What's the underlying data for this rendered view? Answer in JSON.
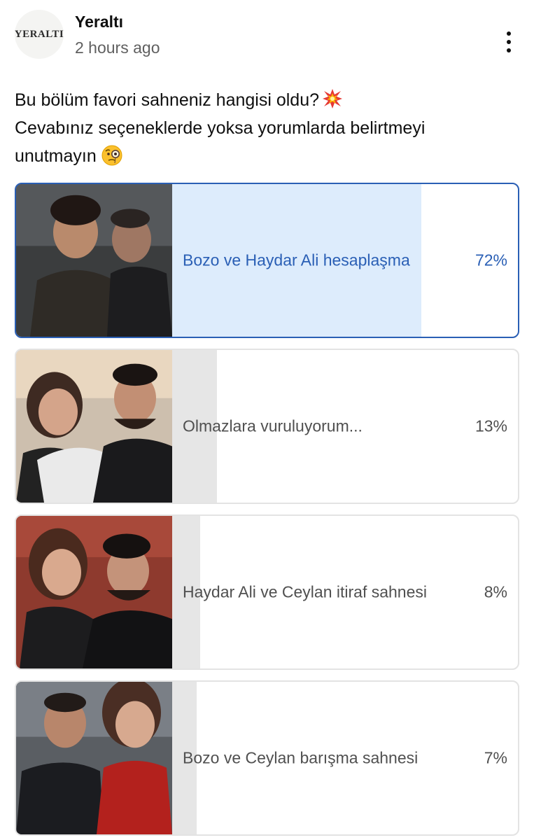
{
  "post": {
    "channel_name": "Yeraltı",
    "avatar_text": "YERALTI",
    "time": "2 hours ago",
    "menu_icon": "more-vertical-icon",
    "text_lines": [
      "Bu bölüm favori sahneniz hangisi oldu?",
      "Cevabınız seçeneklerde yoksa yorumlarda belirtmeyi",
      "unutmayın"
    ],
    "emojis": [
      "collision-emoji",
      "face-with-monocle-emoji"
    ]
  },
  "poll": {
    "accent_color": "#2a5fb5",
    "selected_fill_color": "#ddecfc",
    "fill_color": "#e6e6e6",
    "options": [
      {
        "label": "Bozo ve Haydar Ali hesaplaşma",
        "percent": "72%",
        "fraction": 0.72,
        "selected": true
      },
      {
        "label": "Olmazlara vuruluyorum...",
        "percent": "13%",
        "fraction": 0.13,
        "selected": false
      },
      {
        "label": "Haydar Ali ve Ceylan itiraf sahnesi",
        "percent": "8%",
        "fraction": 0.08,
        "selected": false
      },
      {
        "label": "Bozo ve Ceylan barışma sahnesi",
        "percent": "7%",
        "fraction": 0.07,
        "selected": false
      }
    ]
  }
}
